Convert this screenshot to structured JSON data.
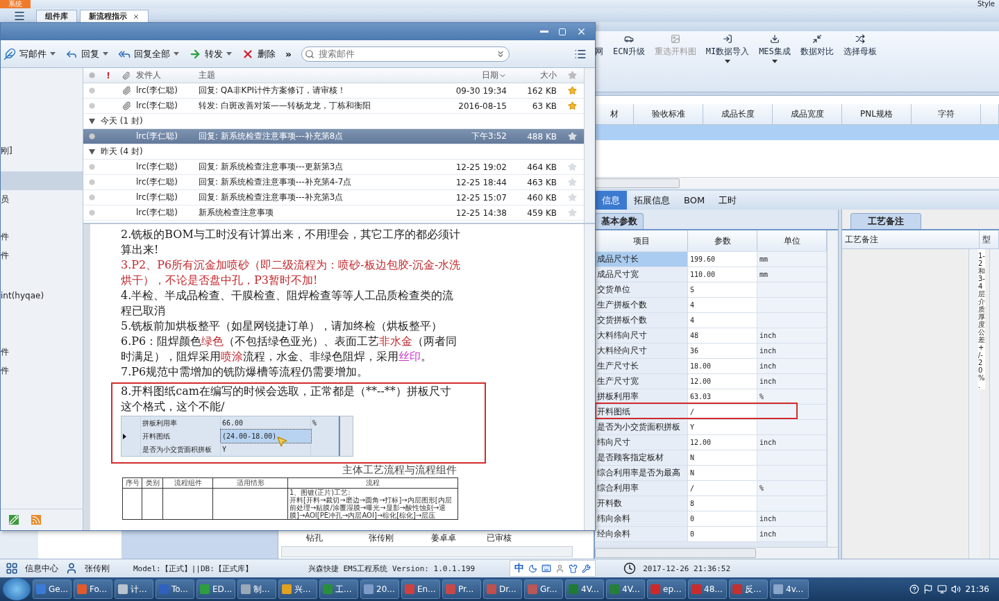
{
  "app": {
    "menu_tab": "系统",
    "style_label": "Style",
    "tabs": [
      {
        "label": "组件库",
        "selected": false,
        "closable": false
      },
      {
        "label": "新流程指示",
        "selected": true,
        "closable": true
      }
    ]
  },
  "mail_window": {
    "toolbar": [
      {
        "label": "写邮件",
        "kind": "compose",
        "dropdown": true
      },
      {
        "label": "回复",
        "kind": "reply",
        "dropdown": true
      },
      {
        "label": "回复全部",
        "kind": "reply_all",
        "dropdown": true
      },
      {
        "label": "转发",
        "kind": "forward",
        "dropdown": true
      },
      {
        "label": "删除",
        "kind": "delete",
        "dropdown": false
      }
    ],
    "more": "»",
    "search": {
      "placeholder": "搜索邮件"
    },
    "folders": [
      {
        "label": "刚]",
        "selected": false
      },
      {
        "selected": true
      },
      {
        "label": "员",
        "selected": false
      },
      {
        "label": "件",
        "selected": false
      },
      {
        "label": "件",
        "selected": false
      },
      {
        "label": "int(hyqae)",
        "selected": false
      },
      {
        "label": "件",
        "selected": false
      },
      {
        "label": "件",
        "selected": false
      }
    ],
    "columns": {
      "flag": "!",
      "sender": "发件人",
      "subject": "主题",
      "date": "日期",
      "size": "大小"
    },
    "rows": [
      {
        "kind": "mail",
        "attachment": true,
        "sender": "lrc(李仁聪)",
        "subject": "回复: QA非KPI计件方案修订，请审核！",
        "date": "09-30 19:34",
        "size": "162 KB",
        "starred": true,
        "selected": false
      },
      {
        "kind": "mail",
        "attachment": true,
        "sender": "lrc(李仁聪)",
        "subject": "转发: 白斑改善对策——转杨龙龙，丁栋和衡阳",
        "date": "2016-08-15",
        "size": "63 KB",
        "starred": true,
        "selected": false
      },
      {
        "kind": "group",
        "label": "今天 (1 封)",
        "expanded": true
      },
      {
        "kind": "mail",
        "attachment": false,
        "sender": "lrc(李仁聪)",
        "subject": "回复: 新系统检查注意事项---补充第8点",
        "date": "下午3:52",
        "size": "488 KB",
        "starred": false,
        "selected": true
      },
      {
        "kind": "group",
        "label": "昨天 (4 封)",
        "expanded": true
      },
      {
        "kind": "mail",
        "attachment": false,
        "sender": "lrc(李仁聪)",
        "subject": "回复: 新系统检查注意事项---更新第3点",
        "date": "12-25 19:02",
        "size": "464 KB",
        "starred": false,
        "selected": false
      },
      {
        "kind": "mail",
        "attachment": false,
        "sender": "lrc(李仁聪)",
        "subject": "回复: 新系统检查注意事项---补充第4-7点",
        "date": "12-25 18:44",
        "size": "463 KB",
        "starred": false,
        "selected": false
      },
      {
        "kind": "mail",
        "attachment": false,
        "sender": "lrc(李仁聪)",
        "subject": "回复: 新系统检查注意事项---补充第3点",
        "date": "12-25 15:07",
        "size": "460 KB",
        "starred": false,
        "selected": false
      },
      {
        "kind": "mail",
        "attachment": false,
        "sender": "lrc(李仁聪)",
        "subject": "新系统检查注意事项",
        "date": "12-25 14:38",
        "size": "459 KB",
        "starred": false,
        "selected": false
      }
    ],
    "document": {
      "paragraphs": [
        {
          "segments": [
            {
              "text": "2.铣板的BOM与工时没有计算出来，不用理会，其它工序的都必须计算出来!"
            }
          ]
        },
        {
          "segments": [
            {
              "text": "3.P2、P6所有沉金加喷砂（即二级流程为：喷砂-板边包胶-沉金-水洗烘干），不论是否盘中孔，P3暂时不加!",
              "color": "#c0282d"
            }
          ]
        },
        {
          "segments": [
            {
              "text": "4.半检、半成品检查、干膜检查、阻焊检查等等人工品质检查类的流程已取消"
            }
          ]
        },
        {
          "segments": [
            {
              "text": "5.铣板前加烘板整平（如星网锐捷订单），请加终检（烘板整平）"
            }
          ]
        },
        {
          "segments": [
            {
              "text": "6.P6：阻焊颜色"
            },
            {
              "text": "绿色",
              "color": "#c0282d"
            },
            {
              "text": "（不包括绿色亚光）、表面工艺"
            },
            {
              "text": "非水金",
              "color": "#c0282d"
            },
            {
              "text": "（两者同时满足），阻焊采用"
            },
            {
              "text": "喷涂",
              "color": "#c0282d"
            },
            {
              "text": "流程，水金、非绿色阻焊，采用"
            },
            {
              "text": "丝印",
              "color": "#cc33cc"
            },
            {
              "text": "。"
            }
          ]
        },
        {
          "segments": [
            {
              "text": "7.P6规范中需增加的铣防爆槽等流程仍需要增加。"
            }
          ]
        }
      ],
      "annotation": {
        "text": "8.开料图纸cam在编写的时候会选取，正常都是（**--**）拼板尺寸这个格式，这个不能/",
        "snapshot_rows": [
          {
            "item": "拼板利用率",
            "value": "66.00",
            "unit": "%",
            "current": false
          },
          {
            "item": "开料图纸",
            "value": "(24.00-18.00)",
            "current": true
          },
          {
            "item": "是否为小交货面积拼板",
            "value": "Y",
            "current": false
          }
        ]
      },
      "heading": "主体工艺流程与流程组件",
      "table": {
        "columns": [
          "序号",
          "类别",
          "流程组件",
          "适用情形",
          "流程"
        ],
        "flow_lines": [
          "1、图镀(正片)工艺:",
          "开料[开料→裁切→磨边→圆角→打标]→内层图形[内层前处理→贴膜/涂覆湿膜→曝光→显影→酸性蚀刻→退膜]→AOI[PE冲孔→内层AOI]→棕化[棕化]→层压"
        ]
      }
    }
  },
  "ribbon": [
    {
      "label": "网",
      "kind": "none",
      "disabled": false,
      "dropdown": false
    },
    {
      "label": "ECN升级",
      "kind": "car",
      "disabled": false,
      "dropdown": false
    },
    {
      "label": "重选开料图",
      "kind": "image",
      "disabled": true,
      "dropdown": false
    },
    {
      "label": "MI数据导入",
      "kind": "import",
      "disabled": false,
      "dropdown": true
    },
    {
      "label": "MES集成",
      "kind": "download",
      "disabled": false,
      "dropdown": true
    },
    {
      "label": "数据对比",
      "kind": "compare",
      "disabled": false,
      "dropdown": false
    },
    {
      "label": "选择母板",
      "kind": "shuffle",
      "disabled": false,
      "dropdown": false
    }
  ],
  "grid": {
    "columns": [
      "材",
      "验收标准",
      "成品长度",
      "成品宽度",
      "PNL规格",
      "字符"
    ],
    "rows": [
      {
        "selected": true
      }
    ]
  },
  "detail_tabs": [
    {
      "label": "信息",
      "selected": true
    },
    {
      "label": "拓展信息",
      "selected": false
    },
    {
      "label": "BOM",
      "selected": false
    },
    {
      "label": "工时",
      "selected": false
    }
  ],
  "params": {
    "tab": "基本参数",
    "columns": [
      "项目",
      "参数",
      "单位"
    ],
    "rows": [
      {
        "item": "成品尺寸长",
        "value": "199.60",
        "unit": "mm",
        "selected": true,
        "flagged": false
      },
      {
        "item": "成品尺寸宽",
        "value": "110.00",
        "unit": "mm",
        "selected": false,
        "flagged": false
      },
      {
        "item": "交货单位",
        "value": "S",
        "selected": false,
        "flagged": false
      },
      {
        "item": "生产拼板个数",
        "value": "4",
        "selected": false,
        "flagged": false
      },
      {
        "item": "交货拼板个数",
        "value": "4",
        "selected": false,
        "flagged": false
      },
      {
        "item": "大料纬向尺寸",
        "value": "48",
        "unit": "inch",
        "selected": false,
        "flagged": false
      },
      {
        "item": "大料经向尺寸",
        "value": "36",
        "unit": "inch",
        "selected": false,
        "flagged": false
      },
      {
        "item": "生产尺寸长",
        "value": "18.00",
        "unit": "inch",
        "selected": false,
        "flagged": false
      },
      {
        "item": "生产尺寸宽",
        "value": "12.00",
        "unit": "inch",
        "selected": false,
        "flagged": false
      },
      {
        "item": "拼板利用率",
        "value": "63.03",
        "unit": "%",
        "selected": false,
        "flagged": false
      },
      {
        "item": "开料图纸",
        "value": "/",
        "selected": false,
        "flagged": true
      },
      {
        "item": "是否为小交货面积拼板",
        "value": "Y",
        "selected": false,
        "flagged": false
      },
      {
        "item": "纬向尺寸",
        "value": "12.00",
        "unit": "inch",
        "selected": false,
        "flagged": false
      },
      {
        "item": "是否顾客指定板材",
        "value": "N",
        "selected": false,
        "flagged": false
      },
      {
        "item": "综合利用率是否为最高",
        "value": "N",
        "selected": false,
        "flagged": false
      },
      {
        "item": "综合利用率",
        "value": "/",
        "unit": "%",
        "selected": false,
        "flagged": false
      },
      {
        "item": "开料数",
        "value": "8",
        "selected": false,
        "flagged": false
      },
      {
        "item": "纬向余料",
        "value": "0",
        "unit": "inch",
        "selected": false,
        "flagged": false
      },
      {
        "item": "经向余料",
        "value": "0",
        "unit": "inch",
        "selected": false,
        "flagged": false
      }
    ]
  },
  "notes": {
    "tab": "工艺备注",
    "columns": [
      "工艺备注",
      "型"
    ],
    "vertical_text": "1-2和3-4层介质厚度公差+/-20%."
  },
  "tree_row": {
    "name": "钻孔",
    "owner": "张传刚",
    "reviewer": "姜卓卓",
    "status": "已审核"
  },
  "status_bar": {
    "info": "信息中心",
    "user": "张传刚",
    "model": "Model:【正式】||DB:【正式库】",
    "product": "兴森快捷 EMS工程系统 Version: 1.0.1.199",
    "ime": "中",
    "clock": "2017-12-26 21:36:52"
  },
  "taskbar": {
    "items": [
      {
        "label": "Ge...",
        "color": "#3a7bd5"
      },
      {
        "label": "Fo...",
        "color": "#e05a2b"
      },
      {
        "label": "计...",
        "color": "#b8c4d0"
      },
      {
        "label": "To...",
        "color": "#3060c0"
      },
      {
        "label": "ED...",
        "color": "#2e9e3e"
      },
      {
        "label": "制...",
        "color": "#9aa8b8"
      },
      {
        "label": "兴...",
        "color": "#e0a020"
      },
      {
        "label": "工...",
        "color": "#2a8f3a"
      },
      {
        "label": "20...",
        "color": "#7d9cc8"
      },
      {
        "label": "En...",
        "color": "#d04040"
      },
      {
        "label": "Pr...",
        "color": "#c84848"
      },
      {
        "label": "Dr...",
        "color": "#c05050"
      },
      {
        "label": "Gr...",
        "color": "#b85858"
      },
      {
        "label": "4V...",
        "color": "#1f7a35"
      },
      {
        "label": "4V...",
        "color": "#247f3a"
      },
      {
        "label": "ep...",
        "color": "#d02828"
      },
      {
        "label": "48...",
        "color": "#c82c2c"
      },
      {
        "label": "反...",
        "color": "#c43030"
      },
      {
        "label": "4v...",
        "color": "#8aa6c8"
      }
    ],
    "time": "21:36"
  }
}
